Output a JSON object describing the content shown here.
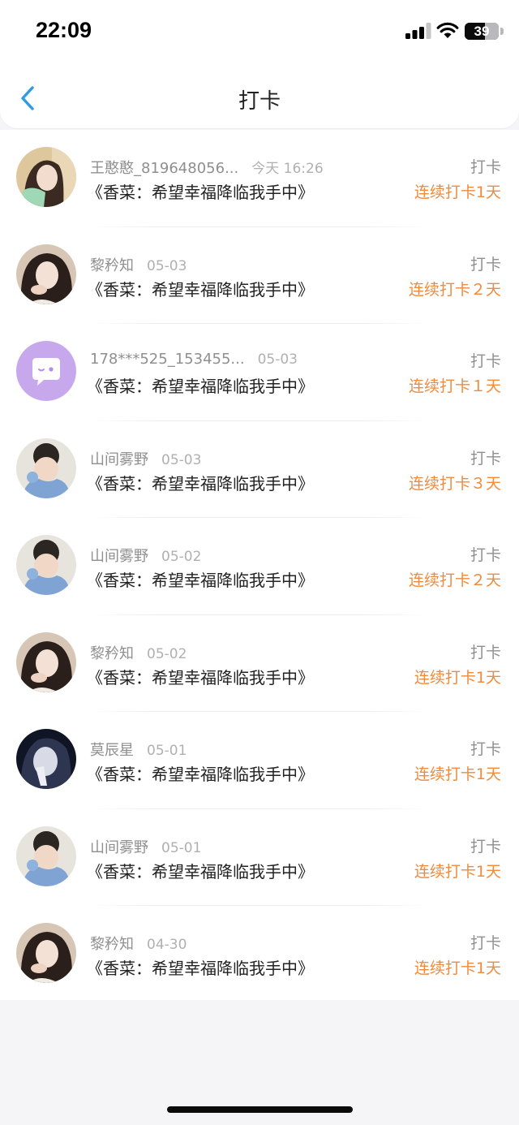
{
  "status_bar": {
    "time": "22:09",
    "battery": "39"
  },
  "nav": {
    "title": "打卡",
    "back_icon": "chevron-left-icon"
  },
  "colors": {
    "accent": "#2f9be5",
    "streak": "#f08a3c",
    "name": "#8f8f8f"
  },
  "items": [
    {
      "name": "王憨憨_819648056...",
      "date": "今天 16:26",
      "book": "《香菜：希望幸福降临我手中》",
      "tag": "打卡",
      "streak": "连续打卡1天",
      "avatar": "photo-avatar-1"
    },
    {
      "name": "黎矜知",
      "date": "05-03",
      "book": "《香菜：希望幸福降临我手中》",
      "tag": "打卡",
      "streak": "连续打卡２天",
      "avatar": "photo-avatar-2"
    },
    {
      "name": "178***525_153455...",
      "date": "05-03",
      "book": "《香菜：希望幸福降临我手中》",
      "tag": "打卡",
      "streak": "连续打卡１天",
      "avatar": "default-chat-avatar"
    },
    {
      "name": "山间雾野",
      "date": "05-03",
      "book": "《香菜：希望幸福降临我手中》",
      "tag": "打卡",
      "streak": "连续打卡３天",
      "avatar": "photo-avatar-3"
    },
    {
      "name": "山间雾野",
      "date": "05-02",
      "book": "《香菜：希望幸福降临我手中》",
      "tag": "打卡",
      "streak": "连续打卡２天",
      "avatar": "photo-avatar-3"
    },
    {
      "name": "黎矜知",
      "date": "05-02",
      "book": "《香菜：希望幸福降临我手中》",
      "tag": "打卡",
      "streak": "连续打卡1天",
      "avatar": "photo-avatar-2"
    },
    {
      "name": "莫辰星",
      "date": "05-01",
      "book": "《香菜：希望幸福降临我手中》",
      "tag": "打卡",
      "streak": "连续打卡1天",
      "avatar": "photo-avatar-4"
    },
    {
      "name": "山间雾野",
      "date": "05-01",
      "book": "《香菜：希望幸福降临我手中》",
      "tag": "打卡",
      "streak": "连续打卡1天",
      "avatar": "photo-avatar-3"
    },
    {
      "name": "黎矜知",
      "date": "04-30",
      "book": "《香菜：希望幸福降临我手中》",
      "tag": "打卡",
      "streak": "连续打卡1天",
      "avatar": "photo-avatar-2"
    }
  ]
}
